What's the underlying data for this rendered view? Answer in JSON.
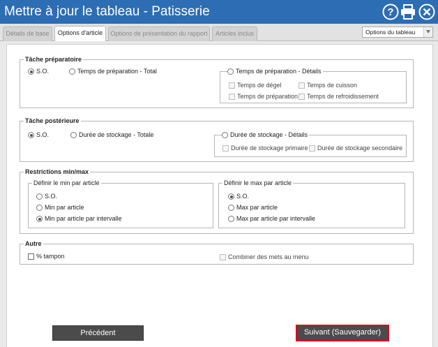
{
  "header": {
    "title": "Mettre à jour le tableau - Patisserie",
    "icons": [
      "help-icon",
      "print-icon",
      "close-icon"
    ],
    "bg_color": "#2d6db3"
  },
  "tabs": [
    {
      "label": "Détails de base",
      "active": false
    },
    {
      "label": "Options d'article",
      "active": true
    },
    {
      "label": "Options de présentation du rapport",
      "active": false
    },
    {
      "label": "Articles inclus",
      "active": false
    }
  ],
  "table_options": {
    "value": "Options du tableau"
  },
  "prep": {
    "legend": "Tâche préparatoire",
    "na": "S.O.",
    "total": "Temps de préparation - Total",
    "details": "Temps de préparation - Détails",
    "thaw": "Temps de dégel",
    "cook": "Temps de cuisson",
    "prep_time": "Temps de préparation",
    "cool": "Temps de refroidissement"
  },
  "post": {
    "legend": "Tâche postérieure",
    "na": "S.O.",
    "total": "Durée de stockage - Totale",
    "details": "Durée de stockage - Détails",
    "primary": "Durée de stockage primaire",
    "secondary": "Durée de stockage secondaire"
  },
  "limits": {
    "legend": "Restrictions min/max",
    "min_legend": "Définir le min par article",
    "min_na": "S.O.",
    "min_per": "Min par article",
    "min_interval": "Min par article par intervalle",
    "max_legend": "Définir le max par article",
    "max_na": "S.O.",
    "max_per": "Max par article",
    "max_interval": "Max par article par intervalle"
  },
  "other": {
    "legend": "Autre",
    "buffer": "% tampon",
    "combine": "Combiner des mets au menu"
  },
  "buttons": {
    "previous": "Précédent",
    "next": "Suivant (Sauvegarder)",
    "next_border": "#d10d1c"
  }
}
